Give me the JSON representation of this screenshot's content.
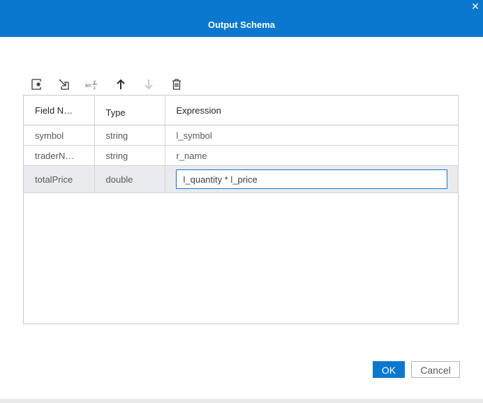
{
  "dialog": {
    "title": "Output Schema",
    "close_icon": "close-icon",
    "accent_color": "#0b78d0"
  },
  "toolbar": {
    "items": [
      {
        "icon": "add-field-icon",
        "enabled": true
      },
      {
        "icon": "import-fields-icon",
        "enabled": true
      },
      {
        "icon": "expression-icon",
        "enabled": true
      },
      {
        "icon": "move-up-icon",
        "enabled": true
      },
      {
        "icon": "move-down-icon",
        "enabled": false
      },
      {
        "icon": "delete-icon",
        "enabled": true
      }
    ]
  },
  "grid": {
    "columns": [
      "Field N…",
      "Type",
      "Expression"
    ],
    "rows": [
      {
        "field": "symbol",
        "type": "string",
        "expression": "l_symbol"
      },
      {
        "field": "traderN…",
        "type": "string",
        "expression": "r_name"
      },
      {
        "field": "totalPrice",
        "type": "double",
        "expression": "l_quantity * l_price"
      }
    ],
    "selected_row": 2
  },
  "buttons": {
    "ok_label": "OK",
    "cancel_label": "Cancel"
  }
}
